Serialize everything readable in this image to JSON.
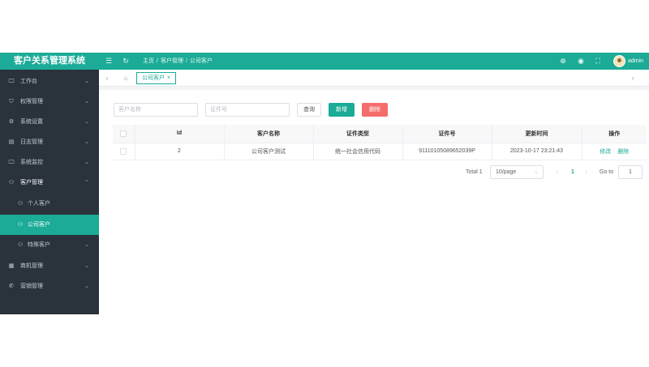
{
  "app": {
    "title": "客户关系管理系统",
    "header_icons": {
      "menu_toggle": "☰",
      "refresh": "↻",
      "language": "⊕",
      "theme": "◉",
      "fullscreen": "⛶"
    },
    "breadcrumb": [
      "主页",
      "客户管理",
      "公司客户"
    ],
    "breadcrumb_sep": "/",
    "user": {
      "name": "admin",
      "caret": "⌄"
    }
  },
  "sidebar": {
    "items": [
      {
        "icon": "🖵",
        "label": "工作台",
        "arrow": "⌄"
      },
      {
        "icon": "⛉",
        "label": "权限管理",
        "arrow": "⌄"
      },
      {
        "icon": "⚙",
        "label": "系统设置",
        "arrow": "⌄"
      },
      {
        "icon": "▤",
        "label": "日志管理",
        "arrow": "⌄"
      },
      {
        "icon": "🖵",
        "label": "系统监控",
        "arrow": "⌄"
      },
      {
        "icon": "⚇",
        "label": "客户管理",
        "arrow": "⌃"
      },
      {
        "icon": "⚇",
        "label": "个人客户",
        "arrow": ""
      },
      {
        "icon": "⚇",
        "label": "公司客户",
        "arrow": ""
      },
      {
        "icon": "⚇",
        "label": "特殊客户",
        "arrow": "⌄"
      },
      {
        "icon": "▦",
        "label": "商机管理",
        "arrow": "⌄"
      },
      {
        "icon": "✆",
        "label": "营销管理",
        "arrow": "⌄"
      }
    ]
  },
  "tabs": {
    "prev": "‹",
    "home_icon": "⌂",
    "active_label": "公司客户",
    "close": "×",
    "next": "›"
  },
  "search": {
    "name_placeholder": "客户名称",
    "id_placeholder": "证件号",
    "query_label": "查询",
    "add_label": "新增",
    "delete_label": "删除"
  },
  "table": {
    "columns": [
      "Id",
      "客户名称",
      "证件类型",
      "证件号",
      "更新时间",
      "操作"
    ],
    "rows": [
      {
        "id": "2",
        "name": "公司客户测试",
        "id_type": "统一社会信用代码",
        "id_number": "911101050896520​39P",
        "updated": "2023-10-17 23:21:43",
        "edit": "修改",
        "delete": "删除"
      }
    ]
  },
  "pagination": {
    "total": "Total 1",
    "page_size": "10/page",
    "page_size_caret": "⌄",
    "prev": "‹",
    "current_page": "1",
    "next": "›",
    "goto_label": "Go to",
    "goto_value": "1"
  },
  "colors": {
    "primary": "#1bab97",
    "sidebar_bg": "#2a333c",
    "danger": "#f56c6c"
  }
}
